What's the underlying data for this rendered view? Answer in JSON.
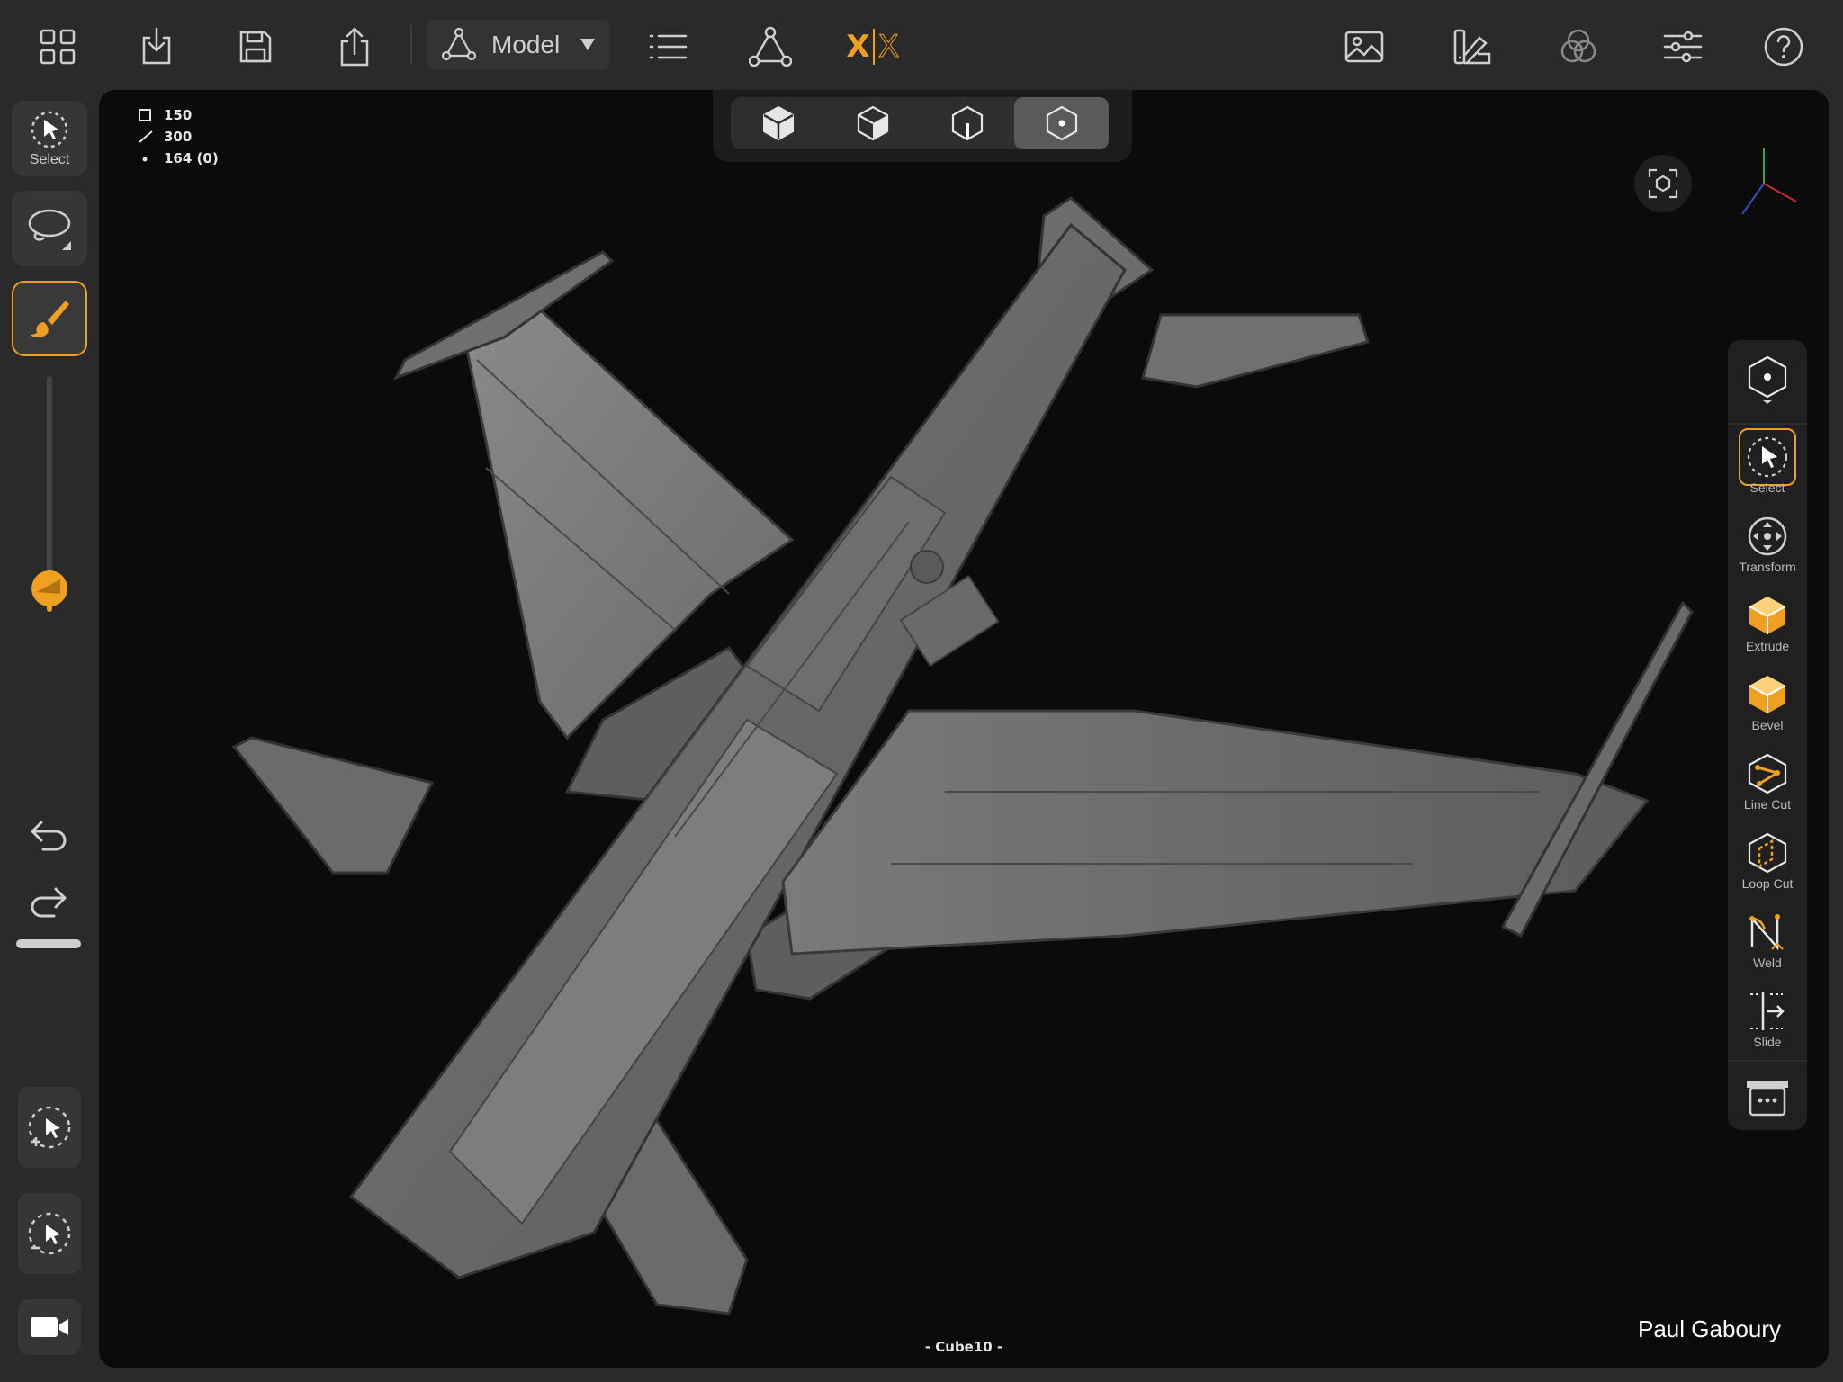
{
  "toolbar": {
    "mode_label": "Model",
    "xsym_left": "X",
    "xsym_right": "X",
    "accent_color": "#f0a020"
  },
  "left_tools": {
    "select_label": "Select"
  },
  "viewport": {
    "stats": {
      "faces": "150",
      "edges": "300",
      "vertices": "164 (0)"
    },
    "object_name": "- Cube10 -",
    "author_credit": "Paul Gaboury"
  },
  "right_tools": [
    {
      "label": "Select",
      "icon": "select-icon"
    },
    {
      "label": "Transform",
      "icon": "transform-icon"
    },
    {
      "label": "Extrude",
      "icon": "extrude-icon"
    },
    {
      "label": "Bevel",
      "icon": "bevel-icon"
    },
    {
      "label": "Line Cut",
      "icon": "line-cut-icon"
    },
    {
      "label": "Loop Cut",
      "icon": "loop-cut-icon"
    },
    {
      "label": "Weld",
      "icon": "weld-icon"
    },
    {
      "label": "Slide",
      "icon": "slide-icon"
    }
  ],
  "brush_size": 0.1
}
